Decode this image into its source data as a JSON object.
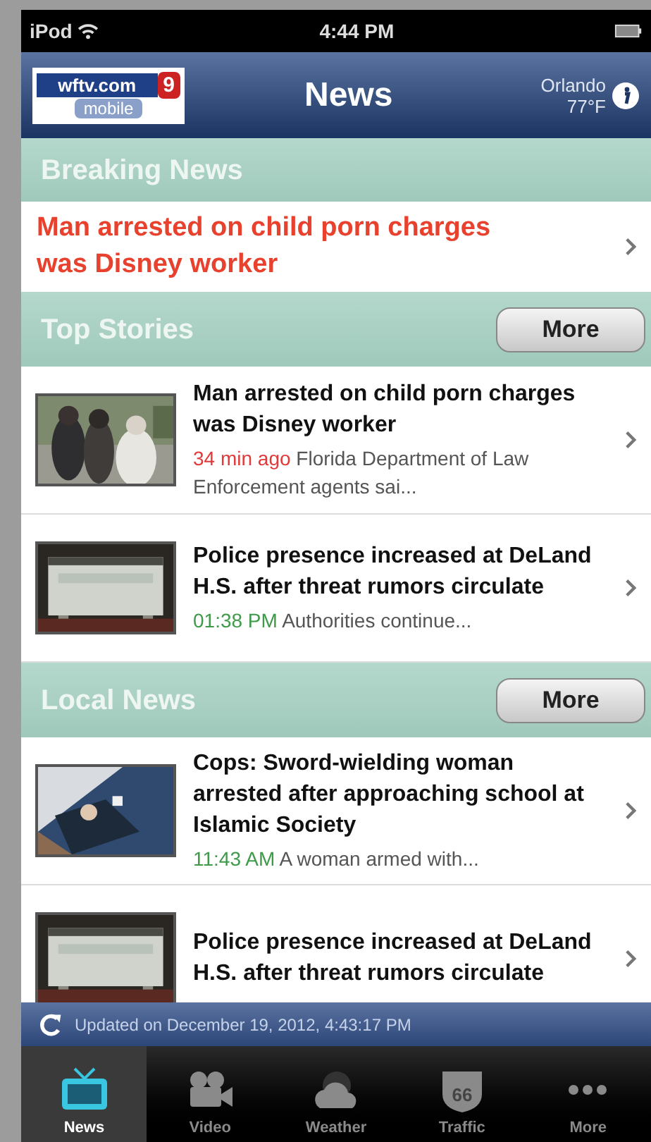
{
  "status_bar": {
    "carrier": "iPod",
    "time": "4:44 PM"
  },
  "nav_bar": {
    "logo": {
      "site": "wftv.com",
      "channel": "9",
      "sub": "mobile"
    },
    "title": "News",
    "city": "Orlando",
    "temperature": "77°F"
  },
  "breaking": {
    "title": "Breaking News",
    "headline": "Man arrested on child porn charges was Disney worker"
  },
  "sections": [
    {
      "title": "Top Stories",
      "more": "More",
      "stories": [
        {
          "headline": "Man arrested on child porn charges was Disney worker",
          "time": "34 min ago",
          "color": "#e03a3a",
          "summary": "Florida Department of Law Enforcement agents sai..."
        },
        {
          "headline": "Police presence increased at DeLand H.S. after threat rumors circulate",
          "time": "01:38 PM",
          "color": "#3f9a4a",
          "summary": "Authorities continue..."
        }
      ]
    },
    {
      "title": "Local News",
      "more": "More",
      "stories": [
        {
          "headline": "Cops: Sword-wielding woman arrested after approaching school at Islamic Society",
          "time": "11:43 AM",
          "color": "#3f9a4a",
          "summary": "A woman armed with..."
        },
        {
          "headline": "Police presence increased at DeLand H.S. after threat rumors circulate"
        }
      ]
    }
  ],
  "updated": "Updated on December 19, 2012, 4:43:17 PM",
  "tabs": [
    {
      "label": "News",
      "kind": "tv",
      "selected": true
    },
    {
      "label": "Video",
      "kind": "camera",
      "selected": false
    },
    {
      "label": "Weather",
      "kind": "weather",
      "selected": false
    },
    {
      "label": "Traffic",
      "kind": "shield",
      "badge": "66",
      "selected": false
    },
    {
      "label": "More",
      "kind": "dots",
      "selected": false
    }
  ]
}
